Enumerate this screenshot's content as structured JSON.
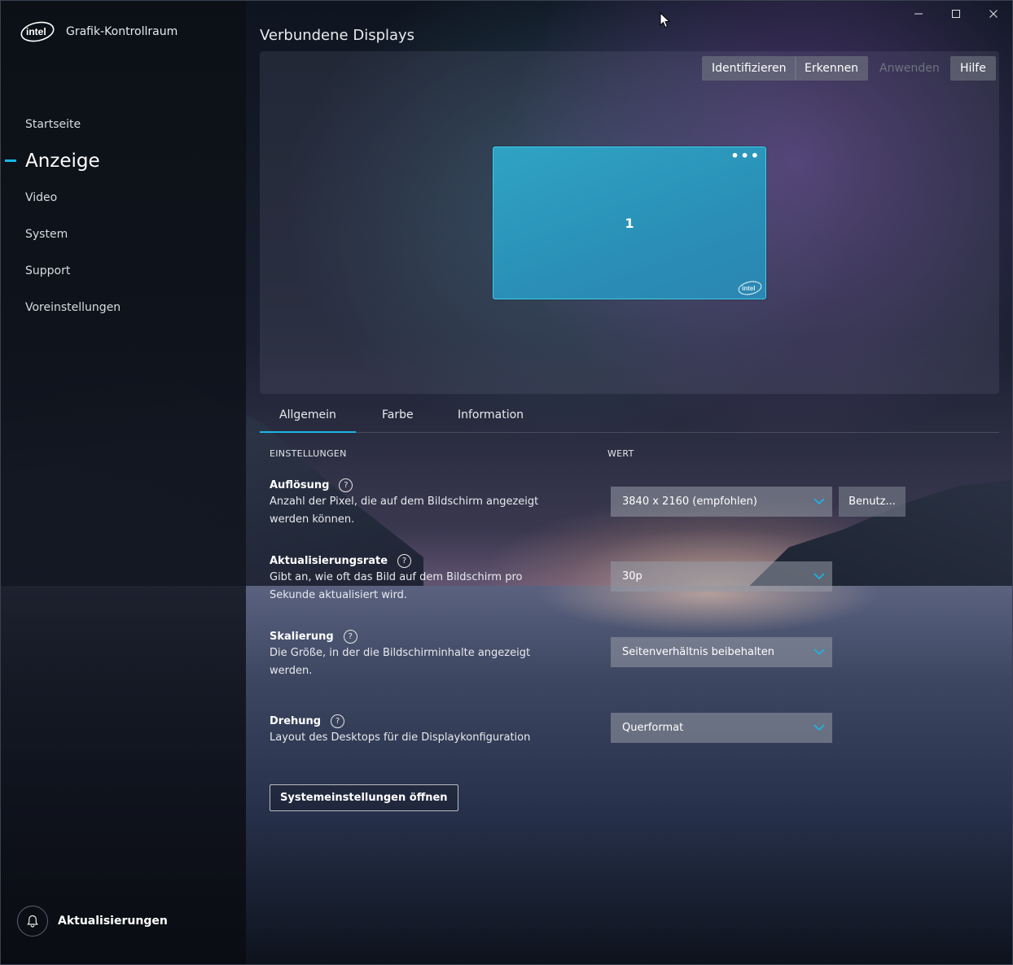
{
  "app": {
    "title": "Grafik-Kontrollraum"
  },
  "sidebar": {
    "items": [
      {
        "label": "Startseite",
        "active": false
      },
      {
        "label": "Anzeige",
        "active": true
      },
      {
        "label": "Video",
        "active": false
      },
      {
        "label": "System",
        "active": false
      },
      {
        "label": "Support",
        "active": false
      },
      {
        "label": "Voreinstellungen",
        "active": false
      }
    ],
    "updates_label": "Aktualisierungen"
  },
  "window_controls": {
    "minimize": "—",
    "maximize": "☐",
    "close": "✕"
  },
  "displays": {
    "title": "Verbundene Displays",
    "buttons": {
      "identify": "Identifizieren",
      "detect": "Erkennen",
      "apply": "Anwenden",
      "help": "Hilfe"
    },
    "monitor": {
      "number": "1",
      "menu": "•••"
    }
  },
  "tabs": [
    {
      "label": "Allgemein",
      "active": true
    },
    {
      "label": "Farbe",
      "active": false
    },
    {
      "label": "Information",
      "active": false
    }
  ],
  "columns": {
    "settings": "EINSTELLUNGEN",
    "value": "WERT"
  },
  "settings": {
    "resolution": {
      "title": "Auflösung",
      "desc": "Anzahl der Pixel, die auf dem Bildschirm angezeigt werden können.",
      "value": "3840 x 2160 (empfohlen)",
      "custom_button": "Benutz..."
    },
    "refresh": {
      "title": "Aktualisierungsrate",
      "desc": "Gibt an, wie oft das Bild auf dem Bildschirm pro Sekunde aktualisiert wird.",
      "value": "30p"
    },
    "scaling": {
      "title": "Skalierung",
      "desc": "Die Größe, in der die Bildschirminhalte angezeigt werden.",
      "value": "Seitenverhältnis beibehalten"
    },
    "rotation": {
      "title": "Drehung",
      "desc": "Layout des Desktops für die Displaykonfiguration",
      "value": "Querformat"
    }
  },
  "system_settings_button": "Systemeinstellungen öffnen",
  "colors": {
    "accent": "#19b6e8",
    "monitor": "#2a8fb6"
  }
}
